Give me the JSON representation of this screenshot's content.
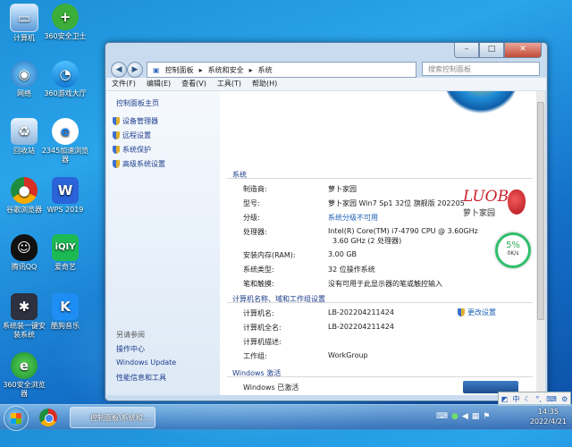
{
  "desktop_icons": [
    {
      "label": "计算机",
      "icon": "computer-icon"
    },
    {
      "label": "360安全卫士",
      "icon": "360-security-icon"
    },
    {
      "label": "网络",
      "icon": "network-icon"
    },
    {
      "label": "360游戏大厅",
      "icon": "360-game-icon"
    },
    {
      "label": "回收站",
      "icon": "recycle-bin-icon"
    },
    {
      "label": "2345加速浏览器",
      "icon": "2345-browser-icon"
    },
    {
      "label": "谷歌浏览器",
      "icon": "chrome-icon"
    },
    {
      "label": "WPS 2019",
      "icon": "wps-icon"
    },
    {
      "label": "腾讯QQ",
      "icon": "qq-icon"
    },
    {
      "label": "爱奇艺",
      "icon": "iqiyi-icon"
    },
    {
      "label": "系统装一键安装系统",
      "icon": "system-install-icon"
    },
    {
      "label": "酷狗音乐",
      "icon": "kugou-icon"
    },
    {
      "label": "360安全浏览器",
      "icon": "360-browser-icon"
    }
  ],
  "window": {
    "breadcrumb": [
      "控制面板",
      "系统和安全",
      "系统"
    ],
    "search_placeholder": "搜索控制面板",
    "menu": [
      "文件(F)",
      "编辑(E)",
      "查看(V)",
      "工具(T)",
      "帮助(H)"
    ],
    "sidebar": {
      "home": "控制面板主页",
      "items": [
        "设备管理器",
        "远程设置",
        "系统保护",
        "高级系统设置"
      ],
      "see_also": "另请参阅",
      "see_also_items": [
        "操作中心",
        "Windows Update",
        "性能信息和工具"
      ]
    },
    "system_section": {
      "title": "系统",
      "rows": [
        {
          "label": "制造商:",
          "value": "萝卜家园"
        },
        {
          "label": "型号:",
          "value": "萝卜家园 Win7 Sp1 32位 旗舰版 202205"
        },
        {
          "label": "分级:",
          "value": "系统分级不可用"
        },
        {
          "label": "处理器:",
          "value": "Intel(R) Core(TM) i7-4790 CPU @ 3.60GHz",
          "value2": "3.60 GHz  (2 处理器)"
        },
        {
          "label": "安装内存(RAM):",
          "value": "3.00 GB"
        },
        {
          "label": "系统类型:",
          "value": "32 位操作系统"
        },
        {
          "label": "笔和触摸:",
          "value": "没有可用于此显示器的笔或触控输入"
        }
      ]
    },
    "logo": {
      "title": "LUOB",
      "subtitle": "萝卜家园"
    },
    "meter": {
      "percent": "5%",
      "speed": "0K/s"
    },
    "computer_section": {
      "title": "计算机名称、域和工作组设置",
      "change_settings": "更改设置",
      "rows": [
        {
          "label": "计算机名:",
          "value": "LB-202204211424"
        },
        {
          "label": "计算机全名:",
          "value": "LB-202204211424"
        },
        {
          "label": "计算机描述:",
          "value": ""
        },
        {
          "label": "工作组:",
          "value": "WorkGroup"
        }
      ]
    },
    "activation_section": {
      "title": "Windows 激活",
      "status": "Windows 已激活"
    }
  },
  "taskbar": {
    "task_label": "控制面板\\系统和...",
    "time": "14:35",
    "date": "2022/4/21"
  },
  "ime": {
    "lang": "中"
  }
}
